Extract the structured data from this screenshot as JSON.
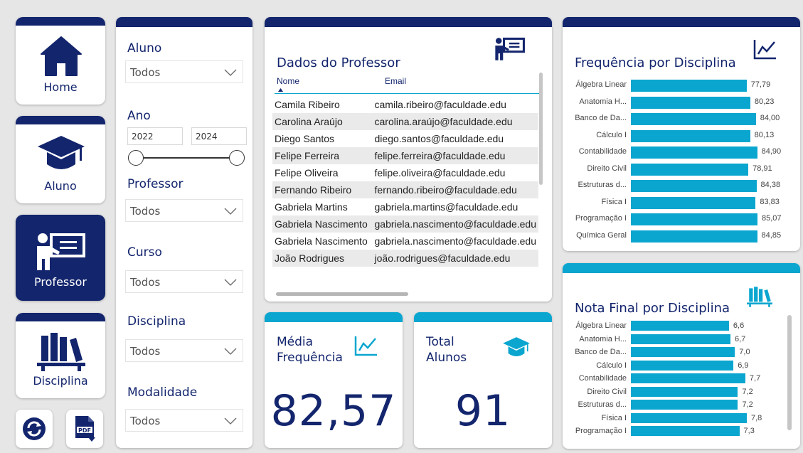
{
  "colors": {
    "navy": "#13256d",
    "teal": "#0aa6cf",
    "background": "#e6e6e6"
  },
  "nav": {
    "home": {
      "label": "Home",
      "icon": "home-icon"
    },
    "aluno": {
      "label": "Aluno",
      "icon": "graduation-cap-icon"
    },
    "professor": {
      "label": "Professor",
      "icon": "teacher-board-icon",
      "active": true
    },
    "disciplina": {
      "label": "Disciplina",
      "icon": "books-icon"
    },
    "refresh_icon": "refresh-icon",
    "pdf_icon": "pdf-download-icon"
  },
  "filters": {
    "aluno": {
      "label": "Aluno",
      "value": "Todos"
    },
    "ano": {
      "label": "Ano",
      "from": "2022",
      "to": "2024"
    },
    "professor": {
      "label": "Professor",
      "value": "Todos"
    },
    "curso": {
      "label": "Curso",
      "value": "Todos"
    },
    "disciplina": {
      "label": "Disciplina",
      "value": "Todos"
    },
    "modalidade": {
      "label": "Modalidade",
      "value": "Todos"
    }
  },
  "professor_table": {
    "title": "Dados do Professor",
    "columns": [
      "Nome",
      "Email"
    ],
    "sorted_by": "Nome",
    "rows": [
      [
        "Camila Ribeiro",
        "camila.ribeiro@faculdade.edu"
      ],
      [
        "Carolina Araújo",
        "carolina.araújo@faculdade.edu"
      ],
      [
        "Diego Santos",
        "diego.santos@faculdade.edu"
      ],
      [
        "Felipe Ferreira",
        "felipe.ferreira@faculdade.edu"
      ],
      [
        "Felipe Oliveira",
        "felipe.oliveira@faculdade.edu"
      ],
      [
        "Fernando Ribeiro",
        "fernando.ribeiro@faculdade.edu"
      ],
      [
        "Gabriela Martins",
        "gabriela.martins@faculdade.edu"
      ],
      [
        "Gabriela Nascimento",
        "gabriela.nascimento@faculdade.edu"
      ],
      [
        "Gabriela Nascimento",
        "gabriela.nascimento@faculdade.edu"
      ],
      [
        "João Rodrigues",
        "joão.rodrigues@faculdade.edu"
      ]
    ]
  },
  "kpis": {
    "media_frequencia": {
      "label_line1": "Média",
      "label_line2": "Frequência",
      "value": "82,57"
    },
    "total_alunos": {
      "label_line1": "Total",
      "label_line2": "Alunos",
      "value": "91"
    }
  },
  "chart_data": [
    {
      "type": "bar",
      "orientation": "horizontal",
      "title": "Frequência por Disciplina",
      "categories": [
        "Álgebra Linear",
        "Anatomia H...",
        "Banco de Da...",
        "Cálculo I",
        "Contabilidade",
        "Direito Civil",
        "Estruturas d...",
        "Física I",
        "Programação I",
        "Química Geral"
      ],
      "values": [
        77.79,
        80.23,
        84.0,
        80.13,
        84.9,
        78.91,
        84.38,
        83.83,
        85.07,
        84.85
      ],
      "labels": [
        "77,79",
        "80,23",
        "84,00",
        "80,13",
        "84,90",
        "78,91",
        "84,38",
        "83,83",
        "85,07",
        "84,85"
      ],
      "xlim": [
        0,
        85.07
      ]
    },
    {
      "type": "bar",
      "orientation": "horizontal",
      "title": "Nota Final por Disciplina",
      "categories": [
        "Álgebra Linear",
        "Anatomia H...",
        "Banco de Da...",
        "Cálculo I",
        "Contabilidade",
        "Direito Civil",
        "Estruturas d...",
        "Física I",
        "Programação I"
      ],
      "values": [
        6.6,
        6.7,
        7.0,
        6.9,
        7.7,
        7.2,
        7.2,
        7.8,
        7.3
      ],
      "labels": [
        "6,6",
        "6,7",
        "7,0",
        "6,9",
        "7,7",
        "7,2",
        "7,2",
        "7,8",
        "7,3"
      ],
      "xlim": [
        0,
        7.8
      ]
    }
  ]
}
